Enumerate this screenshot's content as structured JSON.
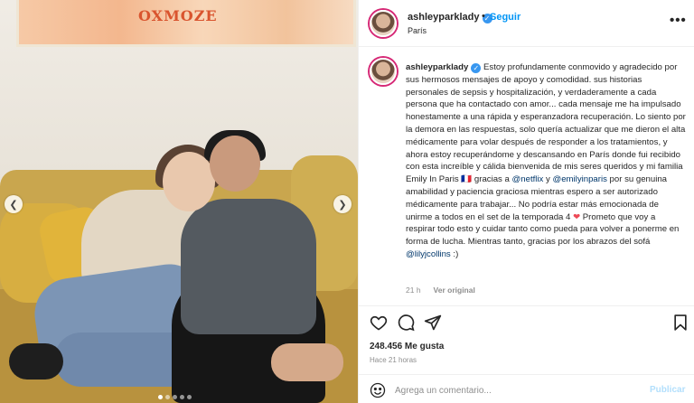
{
  "post": {
    "photo": {
      "painting_text": "OXMOZE",
      "dots_total": 5,
      "dot_active": 1
    },
    "header": {
      "username": "ashleyparklady",
      "separator": "•",
      "follow_label": "Seguir",
      "location": "París",
      "more_label": "•••"
    },
    "caption": {
      "username": "ashleyparklady",
      "text_1": "Estoy profundamente conmovido y agradecido por sus hermosos mensajes de apoyo y comodidad. sus historias personales de sepsis y hospitalización, y verdaderamente a cada persona que ha contactado con amor... cada mensaje me ha impulsado honestamente a una rápida y esperanzadora recuperación. Lo siento por la demora en las respuestas, solo quería actualizar que me dieron el alta médicamente para volar después de responder a los tratamientos, y ahora estoy recuperándome y descansando en París donde fui recibido con esta increíble y cálida bienvenida de mis seres queridos y mi familia Emily In Paris 🇫🇷 gracias a",
      "mention_1": "@netflix",
      "text_2": " y ",
      "mention_2": "@emilyinparis",
      "text_3": " por su genuina amabilidad y paciencia graciosa mientras espero a ser autorizado médicamente para trabajar... No podría estar más emocionada de unirme a todos en el set de la temporada 4 ",
      "heart": "❤",
      "text_4": " Prometo que voy a respirar todo esto y cuidar tanto como pueda para volver a ponerme en forma de lucha. Mientras tanto, gracias por los abrazos del sofá",
      "mention_3": "@lilyjcollins",
      "text_5": " :)",
      "age": "21 h",
      "translate_label": "Ver original"
    },
    "likes": "248.456 Me gusta",
    "time": "Hace 21 horas",
    "comment": {
      "placeholder": "Agrega un comentario...",
      "publish_label": "Publicar"
    }
  },
  "icons": {
    "like": "heart-icon",
    "comment": "comment-icon",
    "share": "share-icon",
    "save": "bookmark-icon",
    "emoji": "emoji-icon",
    "verified": "verified-badge-icon"
  },
  "colors": {
    "accent": "#0095f6",
    "verified": "#3897f0",
    "mention": "#00376b",
    "muted": "#8e8e8e",
    "publish_disabled": "#b2dffc"
  }
}
